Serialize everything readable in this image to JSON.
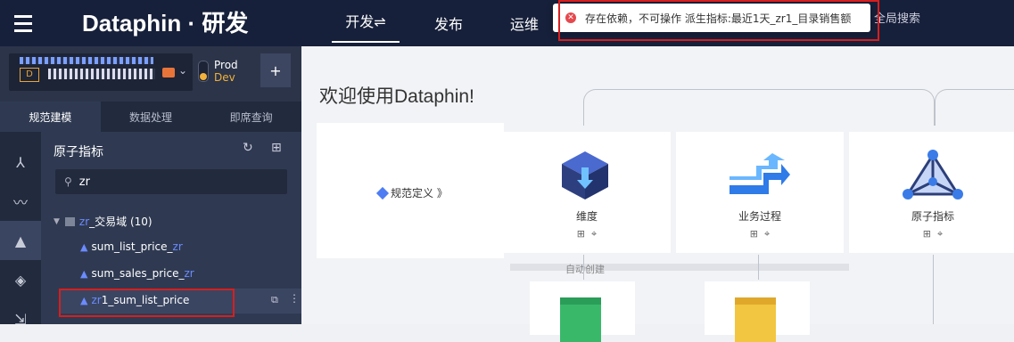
{
  "topbar": {
    "logo": "Dataphin · 研发",
    "nav": [
      {
        "label": "开发⇌",
        "active": true
      },
      {
        "label": "发布",
        "active": false
      },
      {
        "label": "运维",
        "active": false
      }
    ],
    "global_search": "全局搜索"
  },
  "toast": {
    "icon": "close-circle-icon",
    "message": "存在依赖，不可操作 派生指标:最近1天_zr1_目录销售额"
  },
  "project": {
    "badge": "D",
    "env_prod": "Prod",
    "env_dev": "Dev",
    "add_button": "+"
  },
  "tabs": [
    {
      "label": "规范建模",
      "active": true
    },
    {
      "label": "数据处理",
      "active": false
    },
    {
      "label": "即席查询",
      "active": false
    }
  ],
  "panel": {
    "title": "原子指标",
    "search_value": "zr",
    "tree_node": "_交易域 (10)",
    "tree_node_prefix": "zr",
    "items": [
      {
        "pre": "",
        "main": "sum_list_price_",
        "zr": "zr"
      },
      {
        "pre": "",
        "main": "sum_sales_price_",
        "zr": "zr"
      },
      {
        "pre": "zr",
        "main": "1_sum_list_price",
        "zr": ""
      }
    ]
  },
  "main": {
    "welcome": "欢迎使用Dataphin!",
    "definition_label": "规范定义 》",
    "cards": [
      {
        "label": "维度"
      },
      {
        "label": "业务过程"
      },
      {
        "label": "原子指标"
      }
    ],
    "auto_create": "自动创建"
  },
  "colors": {
    "topbar": "#17203a",
    "sidebar": "#2b3449",
    "accent_blue": "#6b8bff",
    "error_red": "#d81e1e",
    "dev_yellow": "#f2b13a"
  }
}
